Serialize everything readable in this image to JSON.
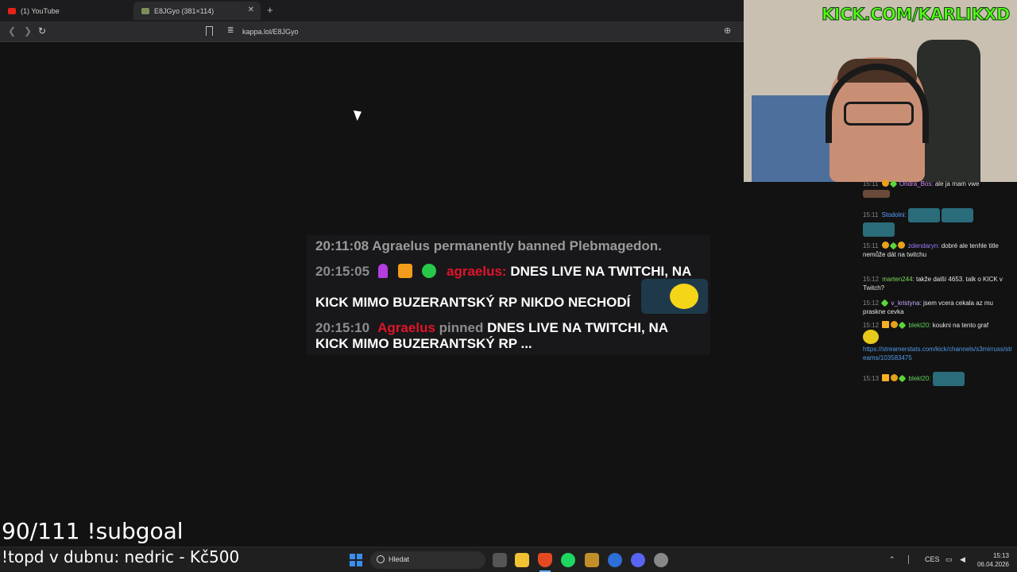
{
  "browser": {
    "tabs": [
      {
        "label": "(1) YouTube",
        "active": false
      },
      {
        "label": "E8JGyo (381×114)",
        "active": true
      }
    ],
    "url": "kappa.lol/E8JGyo",
    "new_tab_label": "+",
    "close_label": "✕"
  },
  "chat_image": {
    "line1": {
      "time": "20:11:08",
      "text": "Agraelus permanently banned Plebmagedon."
    },
    "line2": {
      "time": "20:15:05",
      "user": "agraelus:",
      "text": "DNES LIVE NA TWITCHI, NA"
    },
    "line3": {
      "text": "KICK MIMO BUZERANTSKÝ RP NIKDO NECHODÍ"
    },
    "line4": {
      "time": "20:15:10",
      "user": "Agraelus",
      "action": "pinned",
      "text": "DNES LIVE NA TWITCHI, NA"
    },
    "line5": {
      "text": "KICK MIMO BUZERANTSKÝ RP ..."
    }
  },
  "stream_overlay": {
    "kick_url": "KICK.COM/KARLIKXD",
    "subgoal": "90/111 !subgoal",
    "topd": "!topd v dubnu: nedric - Kč500"
  },
  "side_chat": [
    {
      "time": "15:11",
      "user": "Ondra_Bos:",
      "text": "ale ja mam vwe"
    },
    {
      "time": "15:11",
      "user": "Stodolni:",
      "text": ""
    },
    {
      "time": "15:11",
      "user": "zdendaryn:",
      "text": "dobré ale tenhle title nemůže dát na twitchu"
    },
    {
      "time": "15:12",
      "user": "marten244:",
      "text": "takže další 4653. talk o KICK v Twitch?"
    },
    {
      "time": "15:12",
      "user": "v_kristyna:",
      "text": "jsem vcera cekala az mu praskne cevka"
    },
    {
      "time": "15:12",
      "user": "blekt20:",
      "text": "koukni na tento graf"
    },
    {
      "link": "https://streamerstats.com/kick/channels/s3mirruss/streams/103583475"
    },
    {
      "time": "15:13",
      "user": "blekt20:",
      "text": ""
    }
  ],
  "taskbar": {
    "search_placeholder": "Hledat",
    "language": "CES",
    "time": "15:13",
    "date": "06.04.2026"
  },
  "colors": {
    "kick_green": "#53fc18",
    "agraelus_red": "#e0142b",
    "page_bg": "#121212"
  }
}
